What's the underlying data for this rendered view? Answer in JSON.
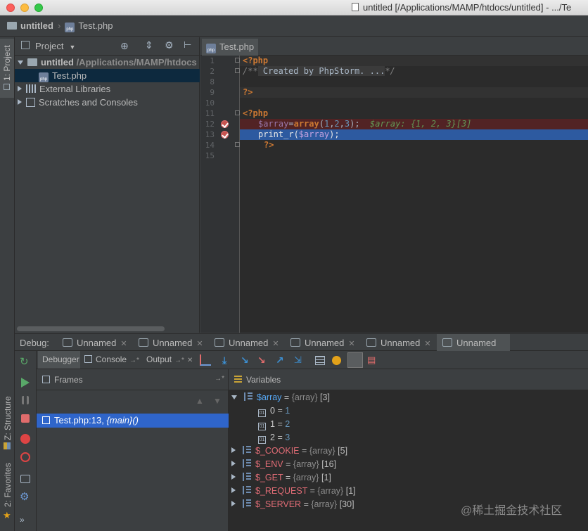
{
  "window": {
    "title": "untitled [/Applications/MAMP/htdocs/untitled] - .../Te"
  },
  "navbar": {
    "project": "untitled",
    "file": "Test.php"
  },
  "left_stripe": {
    "project_tab": "1: Project",
    "structure_tab": "Z: Structure",
    "favorites_tab": "2: Favorites"
  },
  "project_panel": {
    "header": "Project",
    "tree": [
      {
        "label": "untitled",
        "path": "/Applications/MAMP/htdocs"
      },
      {
        "label": "Test.php"
      },
      {
        "label": "External Libraries"
      },
      {
        "label": "Scratches and Consoles"
      }
    ]
  },
  "editor": {
    "tab": "Test.php",
    "lines": [
      {
        "n": "1"
      },
      {
        "n": "2"
      },
      {
        "n": "8"
      },
      {
        "n": "9"
      },
      {
        "n": "10"
      },
      {
        "n": "11"
      },
      {
        "n": "12"
      },
      {
        "n": "13"
      },
      {
        "n": "14"
      },
      {
        "n": "15"
      }
    ],
    "code": {
      "l1": "<?php",
      "l2_cmt_start": "/**",
      "l2_fold": " Created by PhpStorm. ...",
      "l2_cmt_end": "*/",
      "l9": "?>",
      "l11": "<?php",
      "l12_var": "$array",
      "l12_eq": "=",
      "l12_kw": "array",
      "l12_args_open": "(",
      "l12_n1": "1",
      "l12_c1": ",",
      "l12_n2": "2",
      "l12_c2": ",",
      "l12_n3": "3",
      "l12_close": ");",
      "l12_inline": "$array: {1, 2, 3}[3]",
      "l13_fn": "print_r(",
      "l13_var": "$array",
      "l13_close": ");",
      "l14": "?>"
    }
  },
  "debug": {
    "label": "Debug:",
    "tabs": [
      "Unnamed",
      "Unnamed",
      "Unnamed",
      "Unnamed",
      "Unnamed",
      "Unnamed"
    ],
    "subtabs": {
      "debugger": "Debugger",
      "console": "Console",
      "output": "Output"
    },
    "frames_header": "Frames",
    "frame": {
      "location": "Test.php:13,",
      "scope": "{main}()"
    },
    "vars_header": "Variables",
    "variables": [
      {
        "name": "$array",
        "eq": "=",
        "type": "{array}",
        "count": "[3]",
        "expanded": true,
        "children": [
          {
            "key": "0",
            "eq": "=",
            "value": "1"
          },
          {
            "key": "1",
            "eq": "=",
            "value": "2"
          },
          {
            "key": "2",
            "eq": "=",
            "value": "3"
          }
        ]
      },
      {
        "name": "$_COOKIE",
        "eq": "=",
        "type": "{array}",
        "count": "[5]"
      },
      {
        "name": "$_ENV",
        "eq": "=",
        "type": "{array}",
        "count": "[16]"
      },
      {
        "name": "$_GET",
        "eq": "=",
        "type": "{array}",
        "count": "[1]"
      },
      {
        "name": "$_REQUEST",
        "eq": "=",
        "type": "{array}",
        "count": "[1]"
      },
      {
        "name": "$_SERVER",
        "eq": "=",
        "type": "{array}",
        "count": "[30]"
      }
    ]
  },
  "watermark": "@稀土掘金技术社区",
  "colors": {
    "selection_blue": "#2f65ca",
    "breakpoint_red": "#c75450",
    "keyword": "#cc7832",
    "variable": "#9876aa"
  }
}
